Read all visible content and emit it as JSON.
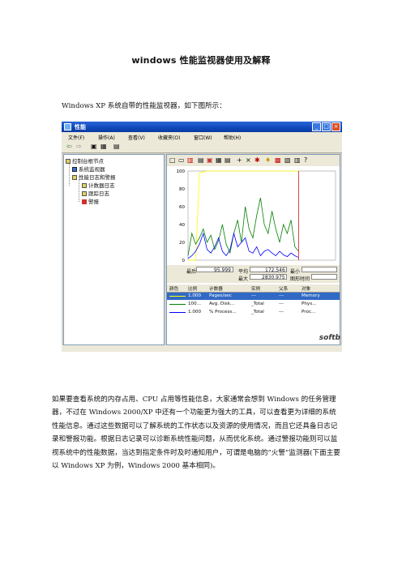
{
  "doc": {
    "title": "windows 性能监视器使用及解释",
    "intro": "Windows XP 系统自带的性能监视器，如下图所示：",
    "paragraph": "如果要查看系统的内存占用、CPU 占用等性能信息，大家通常会想到 Windows 的任务管理器，不过在 Windows 2000/XP 中还有一个功能更为强大的工具，可以查看更为详细的系统性能信息。通过这些数据可以了解系统的工作状态以及资源的使用情况，而且它还具备日志记录和警报功能。根据日志记录可以诊断系统性能问题，从而优化系统。通过警报功能则可以监视系统中的性能数据，当达到指定条件时及时通知用户，可谓是电脑的“火警”监测器(下面主要以 Windows XP 为例，Windows 2000 基本相同)。"
  },
  "window": {
    "title": "性能",
    "menus": [
      "文件(F)",
      "操作(A)",
      "查看(V)",
      "收藏夹(O)",
      "窗口(W)",
      "帮助(H)"
    ],
    "tree": {
      "root": "控制台根节点",
      "monitor": "系统监视器",
      "logs": "性能日志和警报",
      "counter_logs": "计数器日志",
      "trace_logs": "跟踪日志",
      "alerts": "警报"
    },
    "stats": {
      "last_label": "最后",
      "last_value": "95.999",
      "avg_label": "平均",
      "avg_value": "172.546",
      "min_label": "最小",
      "max_label": "最大",
      "max_value": "2830.975",
      "duration_label": "图形时间"
    },
    "grid": {
      "headers": [
        "颜色",
        "比例",
        "计数器",
        "实例",
        "父系",
        "对象"
      ],
      "rows": [
        {
          "scale": "1.000",
          "counter": "Pages/sec",
          "instance": "---",
          "parent": "---",
          "object": "Memory"
        },
        {
          "scale": "100...",
          "counter": "Avg. Disk...",
          "instance": "_Total",
          "parent": "---",
          "object": "Phys..."
        },
        {
          "scale": "1.000",
          "counter": "% Process...",
          "instance": "_Total",
          "parent": "---",
          "object": "Proc..."
        }
      ]
    },
    "brand": "softb"
  },
  "chart_data": {
    "type": "line",
    "ylim": [
      0,
      100
    ],
    "yticks": [
      "100",
      "80",
      "60",
      "40",
      "20",
      "0"
    ],
    "series": [
      {
        "color": "#ffff00",
        "values": [
          0,
          0,
          0,
          98,
          99,
          100,
          100,
          100,
          100,
          100,
          100,
          100,
          100,
          100,
          100,
          100,
          100,
          100,
          100,
          100,
          100,
          100,
          100,
          100,
          100,
          100,
          100,
          100,
          100,
          100
        ]
      },
      {
        "color": "#008000",
        "values": [
          5,
          30,
          18,
          25,
          35,
          20,
          28,
          12,
          22,
          40,
          18,
          8,
          30,
          45,
          20,
          60,
          35,
          25,
          50,
          70,
          40,
          30,
          55,
          35,
          20,
          40,
          30,
          45,
          15,
          10
        ]
      },
      {
        "color": "#0000ff",
        "values": [
          2,
          5,
          10,
          18,
          30,
          12,
          8,
          15,
          25,
          10,
          5,
          12,
          30,
          15,
          20,
          25,
          10,
          8,
          15,
          5,
          10,
          12,
          8,
          5,
          10,
          6,
          4,
          8,
          5,
          3
        ]
      }
    ]
  }
}
